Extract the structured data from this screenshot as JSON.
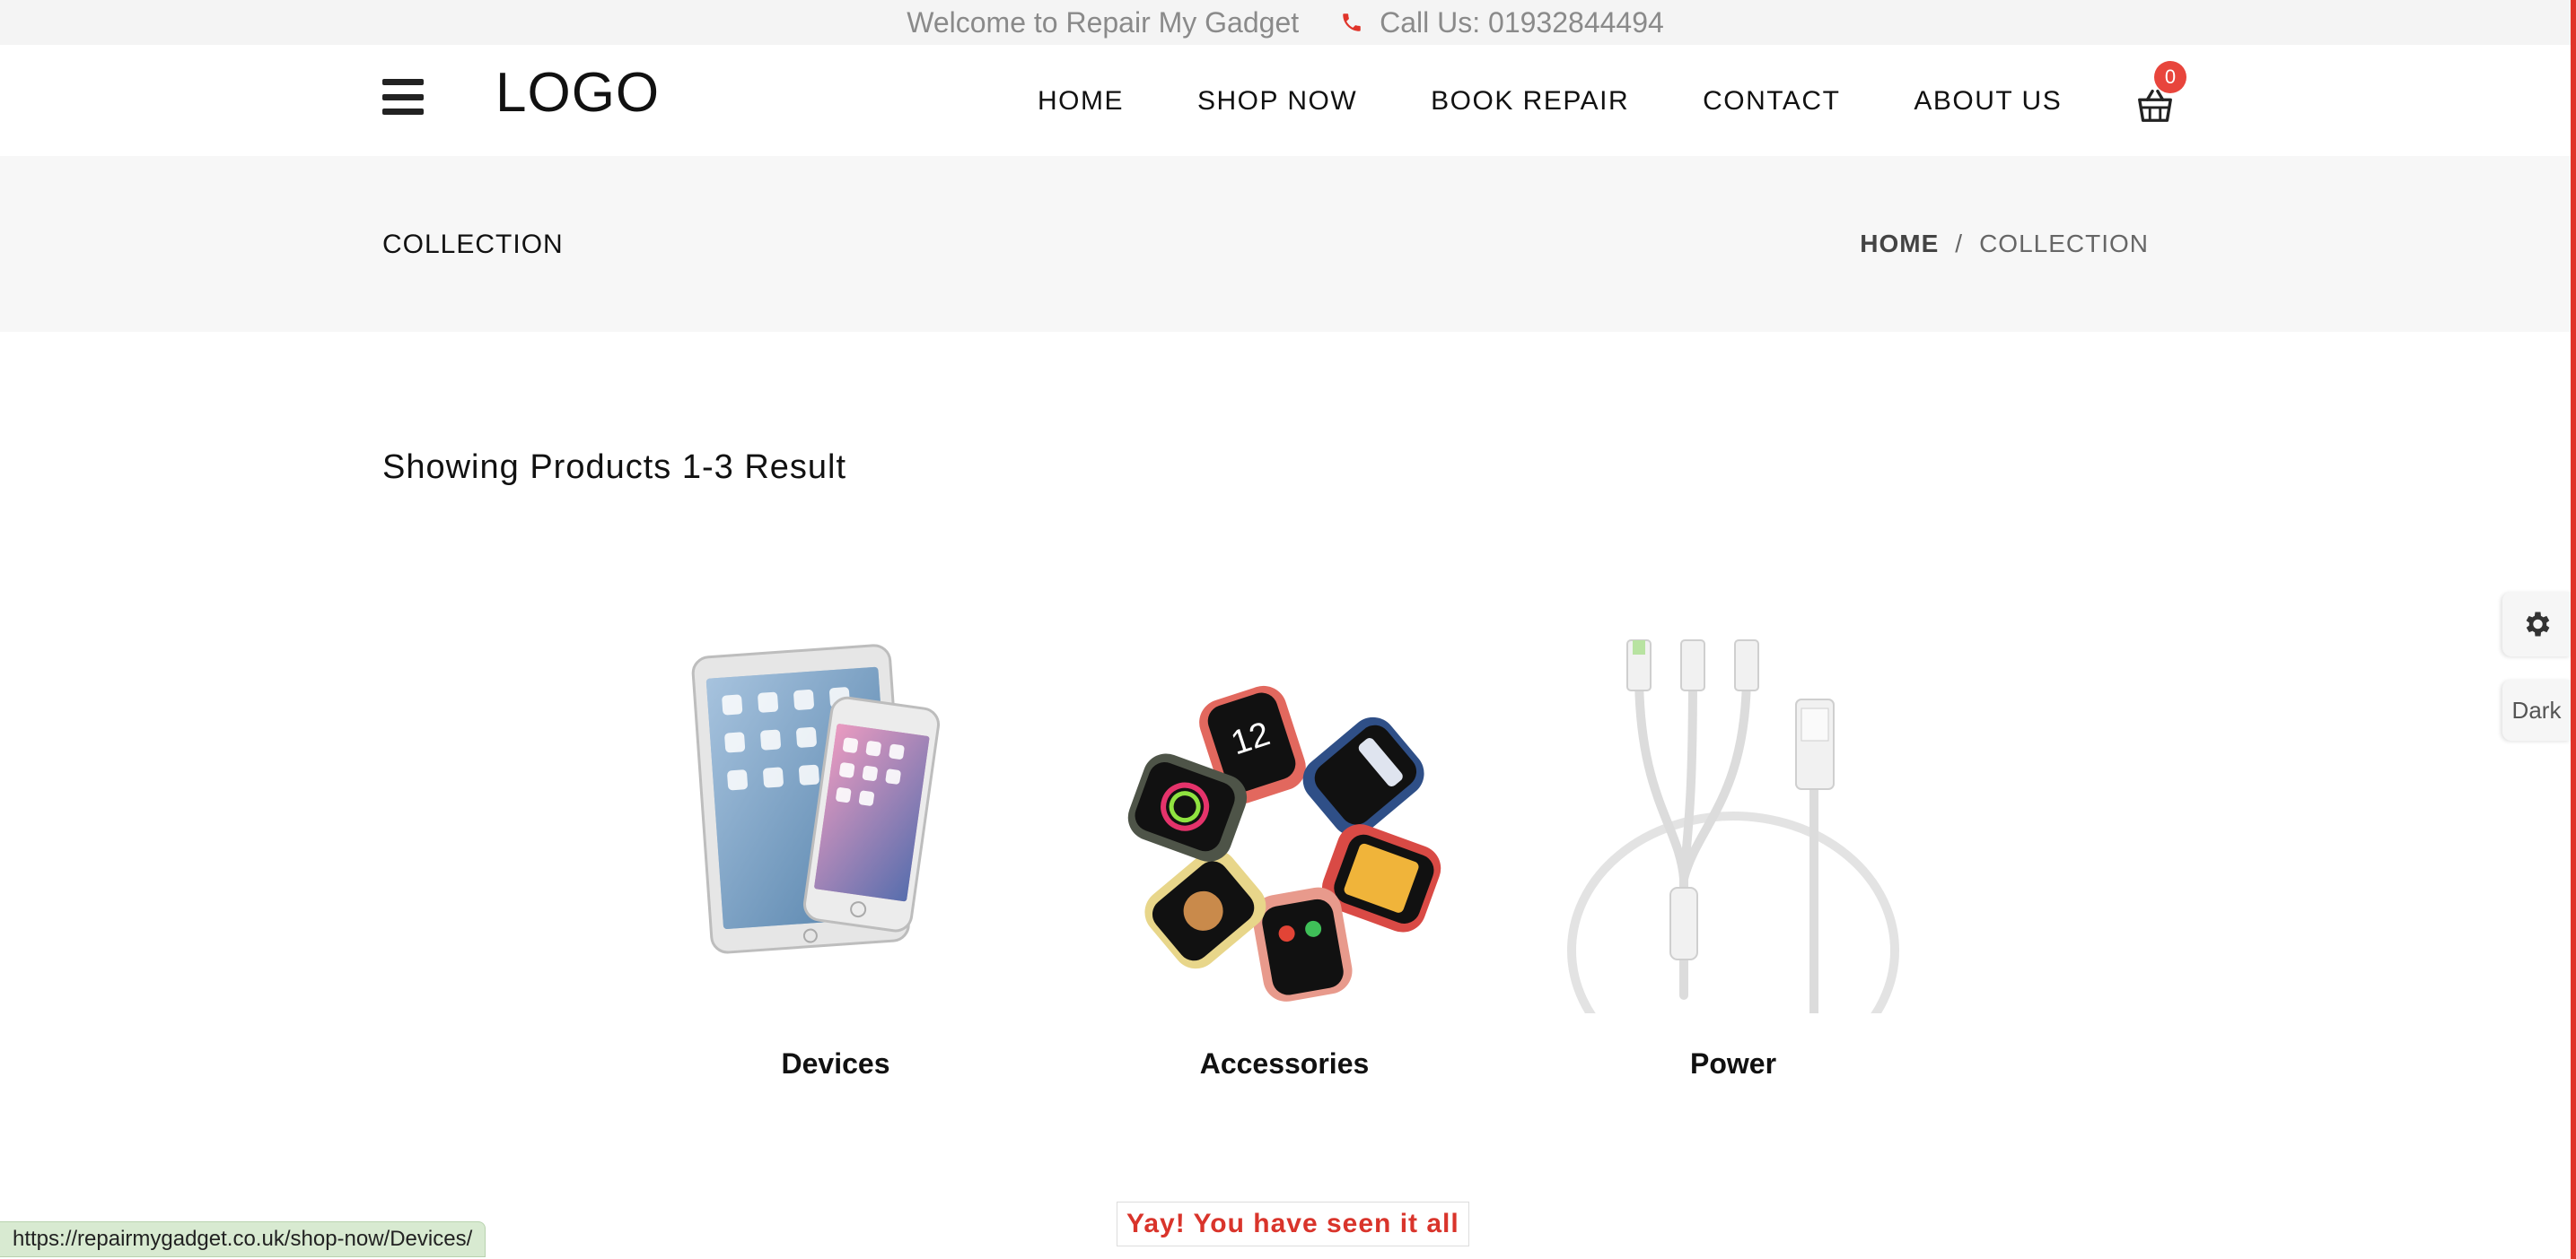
{
  "topbar": {
    "welcome": "Welcome to Repair My Gadget",
    "call": "Call Us: 01932844494",
    "phone_icon": "phone-icon"
  },
  "header": {
    "menu_icon": "hamburger-menu-icon",
    "logo": "LOGO",
    "nav": [
      "HOME",
      "SHOP NOW",
      "BOOK REPAIR",
      "CONTACT",
      "ABOUT US"
    ],
    "cart_icon": "basket-icon",
    "cart_count": "0"
  },
  "banner": {
    "title": "COLLECTION",
    "breadcrumb_home": "HOME",
    "breadcrumb_sep": "/",
    "breadcrumb_current": "COLLECTION"
  },
  "results": {
    "text": "Showing Products 1-3 Result"
  },
  "products": [
    {
      "name": "Devices",
      "image": "tablet-and-phone"
    },
    {
      "name": "Accessories",
      "image": "smart-watches"
    },
    {
      "name": "Power",
      "image": "charging-cable"
    }
  ],
  "side": {
    "settings_icon": "gear-icon",
    "dark_label": "Dark"
  },
  "status": {
    "url": "https://repairmygadget.co.uk/shop-now/Devices/",
    "end_message": "Yay! You have seen it all"
  },
  "colors": {
    "accent": "#e8453c",
    "band": "#f7f7f7",
    "topbar": "#f4f4f4"
  }
}
